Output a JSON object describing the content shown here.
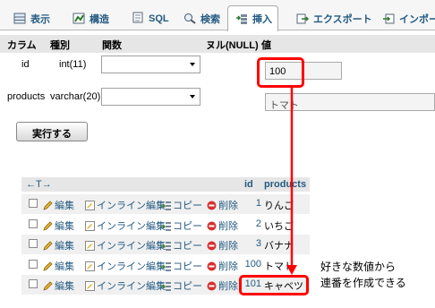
{
  "tabs": [
    {
      "label": "表示",
      "icon": "table-icon"
    },
    {
      "label": "構造",
      "icon": "structure-icon"
    },
    {
      "label": "SQL",
      "icon": "sql-icon"
    },
    {
      "label": "検索",
      "icon": "search-icon"
    },
    {
      "label": "挿入",
      "icon": "insert-icon"
    },
    {
      "label": "エクスポート",
      "icon": "export-icon"
    },
    {
      "label": "インポート",
      "icon": "import-icon"
    }
  ],
  "insert_form": {
    "headers": {
      "column": "カラム",
      "type": "種別",
      "function": "関数",
      "null": "ヌル(NULL)",
      "value": "値"
    },
    "fields": [
      {
        "name": "id",
        "type": "int(11)",
        "value": "100"
      },
      {
        "name": "products",
        "type": "varchar(20)",
        "value": "トマト"
      }
    ],
    "execute_label": "実行する"
  },
  "results": {
    "nav_arrows": "←T→",
    "columns": [
      "id",
      "products"
    ],
    "actions": {
      "edit": "編集",
      "inline_edit": "インライン編集",
      "copy": "コピー",
      "delete": "削除"
    },
    "rows": [
      {
        "id": "1",
        "products": "りんご"
      },
      {
        "id": "2",
        "products": "いちご"
      },
      {
        "id": "3",
        "products": "バナナ"
      },
      {
        "id": "100",
        "products": "トマト"
      },
      {
        "id": "101",
        "products": "キャベツ"
      }
    ]
  },
  "annotation": {
    "line1": "好きな数値から",
    "line2": "連番を作成できる"
  },
  "colors": {
    "highlight": "#ff0000",
    "link": "#235a81"
  }
}
